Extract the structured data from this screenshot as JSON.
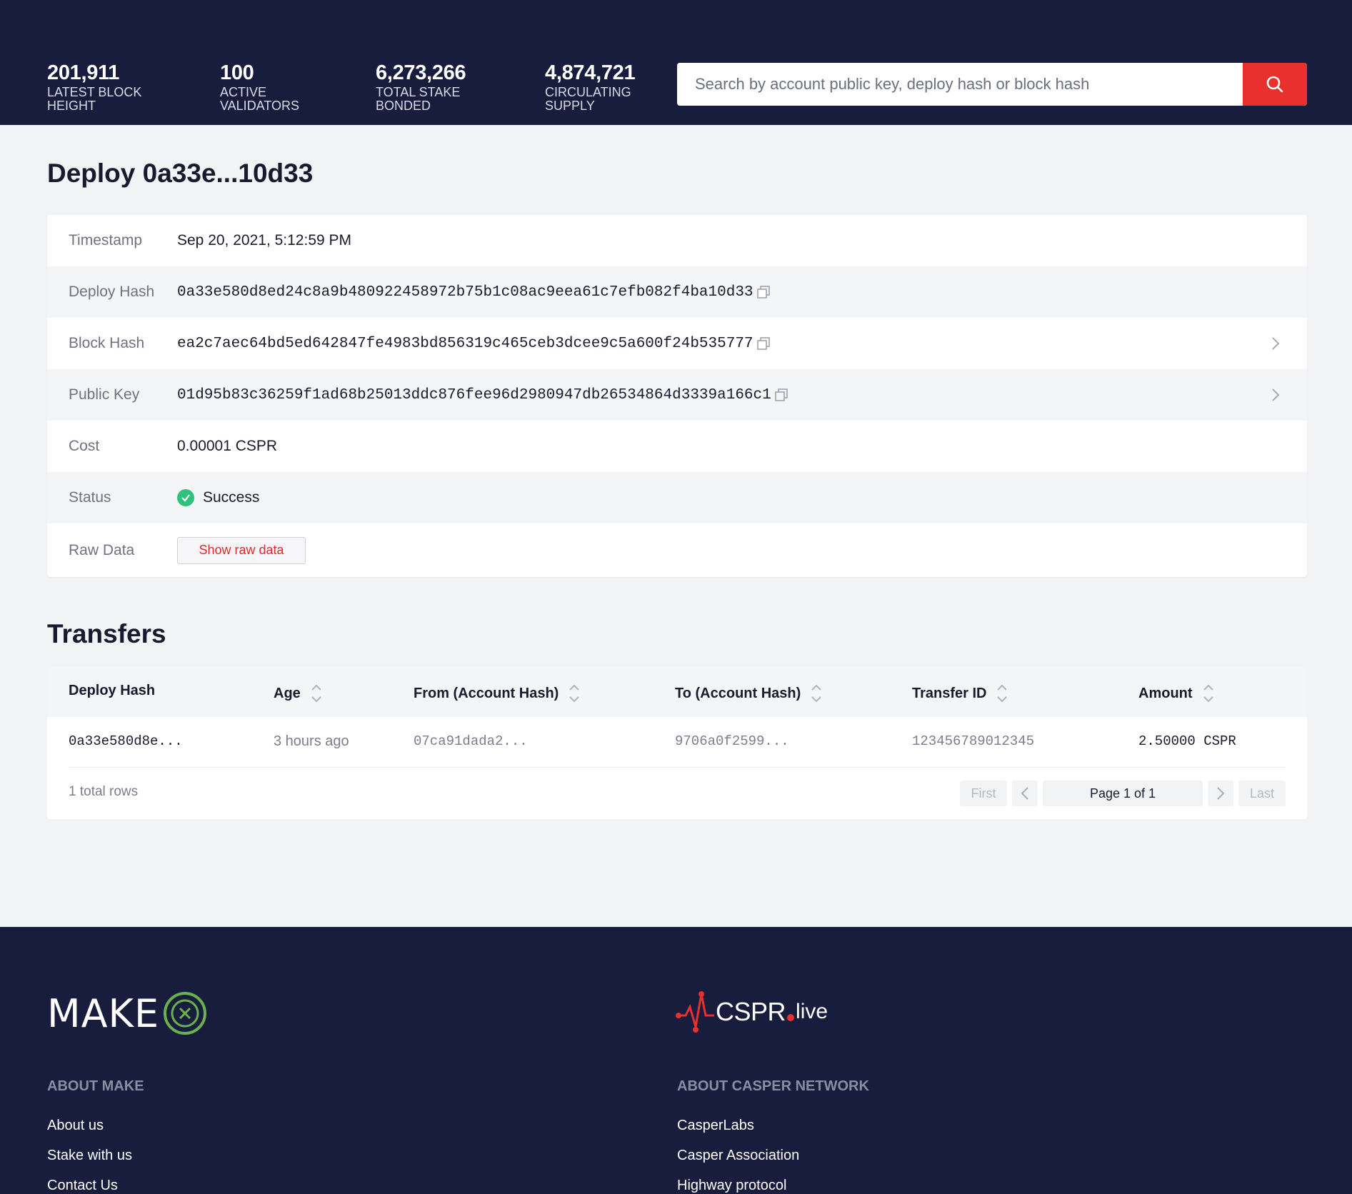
{
  "stats": [
    {
      "value": "201,911",
      "label1": "LATEST BLOCK",
      "label2": "HEIGHT"
    },
    {
      "value": "100",
      "label1": "ACTIVE",
      "label2": "VALIDATORS"
    },
    {
      "value": "6,273,266",
      "label1": "TOTAL STAKE",
      "label2": "BONDED"
    },
    {
      "value": "4,874,721",
      "label1": "CIRCULATING",
      "label2": "SUPPLY"
    }
  ],
  "search": {
    "placeholder": "Search by account public key, deploy hash or block hash",
    "icon": "search-icon"
  },
  "deploy": {
    "title": "Deploy 0a33e...10d33",
    "rows": {
      "timestamp": {
        "label": "Timestamp",
        "value": "Sep 20, 2021, 5:12:59 PM"
      },
      "deploy_hash": {
        "label": "Deploy Hash",
        "value": "0a33e580d8ed24c8a9b480922458972b75b1c08ac9eea61c7efb082f4ba10d33"
      },
      "block_hash": {
        "label": "Block Hash",
        "value": "ea2c7aec64bd5ed642847fe4983bd856319c465ceb3dcee9c5a600f24b535777"
      },
      "public_key": {
        "label": "Public Key",
        "value": "01d95b83c36259f1ad68b25013ddc876fee96d2980947db26534864d3339a166c1"
      },
      "cost": {
        "label": "Cost",
        "value": "0.00001 CSPR"
      },
      "status": {
        "label": "Status",
        "value": "Success"
      },
      "raw": {
        "label": "Raw Data",
        "button": "Show raw data"
      }
    }
  },
  "transfers": {
    "title": "Transfers",
    "columns": [
      "Deploy Hash",
      "Age",
      "From (Account Hash)",
      "To (Account Hash)",
      "Transfer ID",
      "Amount"
    ],
    "rows": [
      {
        "deploy_hash": "0a33e580d8e...",
        "age": "3 hours ago",
        "from": "07ca91dada2...",
        "to": "9706a0f2599...",
        "transfer_id": "123456789012345",
        "amount": "2.50000 CSPR"
      }
    ],
    "total": "1 total rows",
    "pagination": {
      "first": "First",
      "page": "Page 1 of 1",
      "last": "Last"
    }
  },
  "footer": {
    "make_logo": "MAKE",
    "cspr_logo_main": "CSPR",
    "cspr_logo_suffix": "live",
    "about_make": {
      "heading": "ABOUT MAKE",
      "links": [
        "About us",
        "Stake with us",
        "Contact Us"
      ]
    },
    "about_casper": {
      "heading": "ABOUT CASPER NETWORK",
      "links": [
        "CasperLabs",
        "Casper Association",
        "Highway protocol"
      ]
    }
  },
  "colors": {
    "navy": "#181d3d",
    "accent_red": "#e8302d",
    "success_green": "#30c27b",
    "make_green": "#6ab04c"
  }
}
